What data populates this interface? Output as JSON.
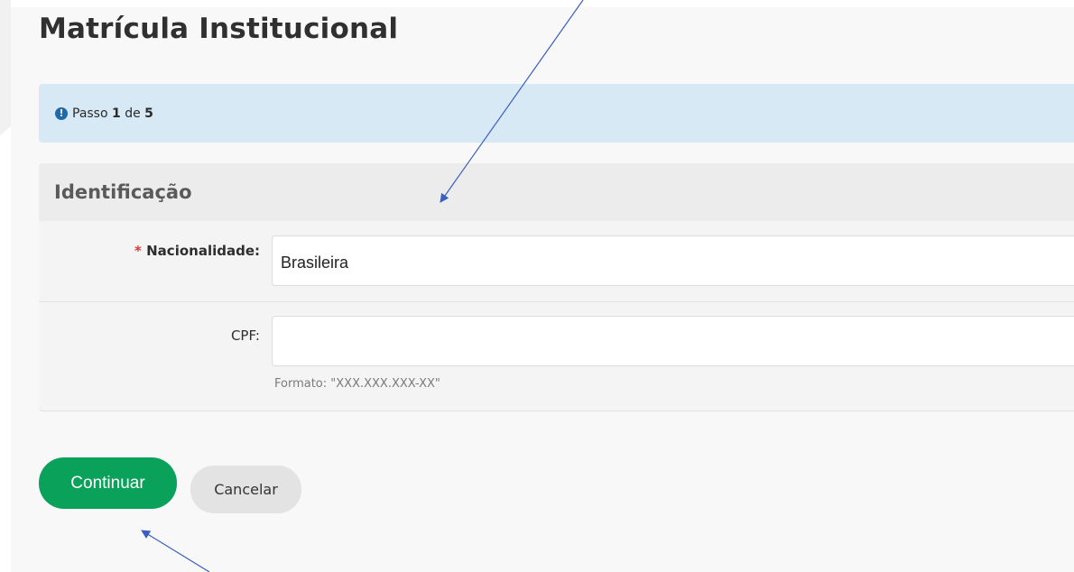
{
  "page": {
    "title": "Matrícula Institucional"
  },
  "alert": {
    "prefix": "Passo",
    "current": "1",
    "middle": "de",
    "total": "5"
  },
  "section": {
    "title": "Identificação"
  },
  "form": {
    "nationality": {
      "required_mark": "*",
      "label": "Nacionalidade:",
      "value": "Brasileira"
    },
    "cpf": {
      "label": "CPF:",
      "value": "",
      "hint": "Formato: \"XXX.XXX.XXX-XX\""
    }
  },
  "actions": {
    "continue_label": "Continuar",
    "cancel_label": "Cancelar"
  },
  "colors": {
    "primary": "#0aa15a",
    "alert_bg": "#d6e9f5",
    "info_icon": "#1f6aa8",
    "required": "#d23b3b",
    "arrow": "#3b5fbf"
  }
}
